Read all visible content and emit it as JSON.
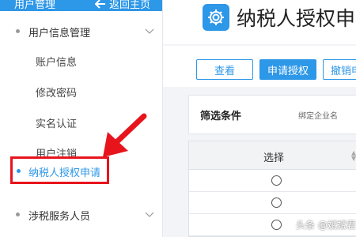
{
  "sidebar": {
    "header_title": "用户管理",
    "back_label": "返回主页",
    "groups": [
      {
        "label": "用户信息管理",
        "icon": "chevron-up-icon"
      },
      {
        "label": "涉税服务人员",
        "icon": "chevron-down-icon"
      }
    ],
    "items": [
      {
        "label": "账户信息"
      },
      {
        "label": "修改密码"
      },
      {
        "label": "实名认证"
      },
      {
        "label": "用户注销"
      },
      {
        "label": "纳税人授权申请",
        "active": true
      }
    ]
  },
  "main": {
    "page_title": "纳税人授权申",
    "buttons": [
      {
        "label": "查看",
        "style": "outline"
      },
      {
        "label": "申请授权",
        "style": "primary"
      },
      {
        "label": "撤销申",
        "style": "outline"
      }
    ],
    "filter": {
      "title": "筛选条件",
      "hint": "绑定企业名"
    },
    "table": {
      "column_header": "选择",
      "rows": 4
    }
  },
  "watermark": {
    "text": "头条 @斌斌君"
  },
  "colors": {
    "accent": "#2d97e8",
    "highlight": "#e8141c"
  }
}
